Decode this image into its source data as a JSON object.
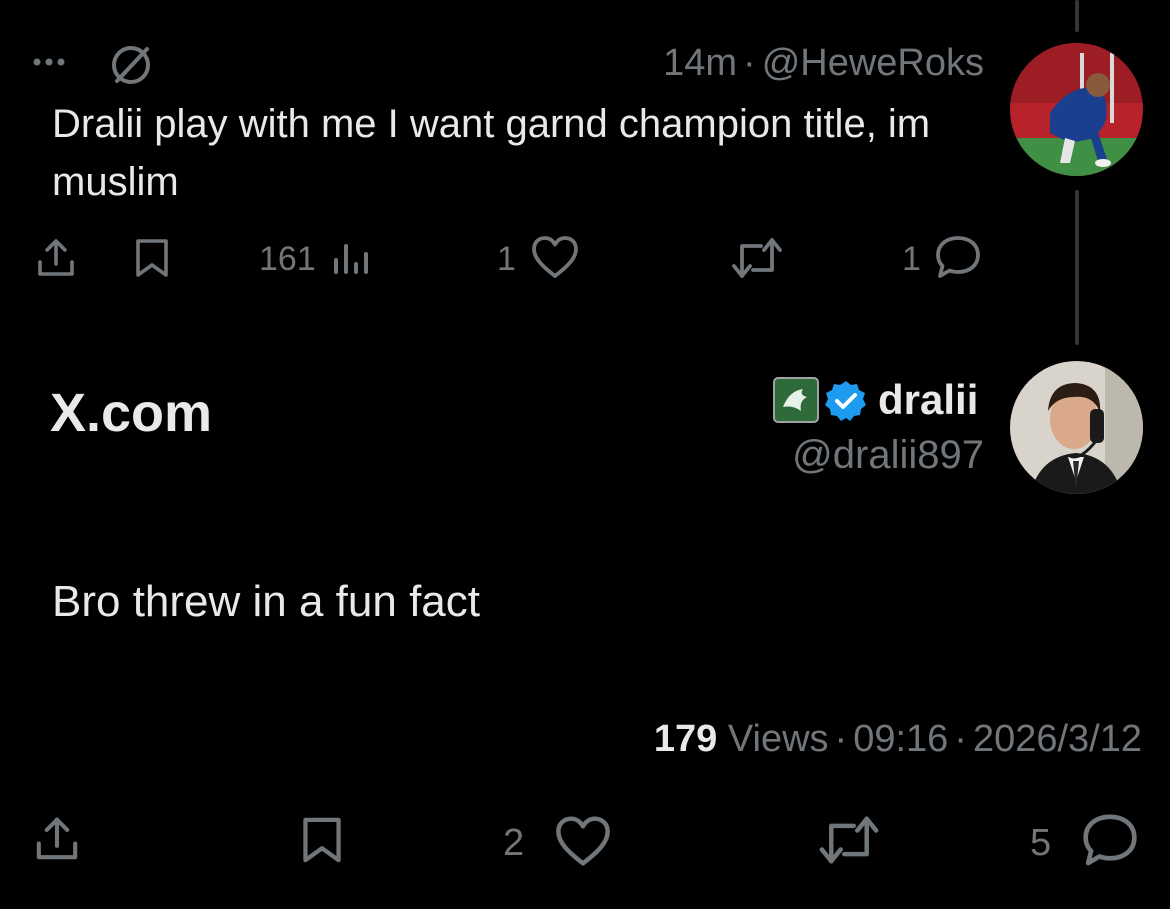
{
  "parent_tweet": {
    "time": "14m",
    "separator": "·",
    "handle": "@HeweRoks",
    "text": "Dralii play with me I want garnd champion title, im muslim",
    "views": "161",
    "likes": "1",
    "replies": "1"
  },
  "main_tweet": {
    "site_label": "X.com",
    "display_name": "dralii",
    "handle": "@dralii897",
    "text": "Bro threw in a fun fact",
    "views_count": "179",
    "views_label": "Views",
    "separator": "·",
    "time": "09:16",
    "date": "2026/3/12",
    "likes": "2",
    "replies": "5"
  },
  "colors": {
    "background": "#000000",
    "text": "#e7e9ea",
    "secondary": "#71767b",
    "verified": "#1d9bf0"
  }
}
